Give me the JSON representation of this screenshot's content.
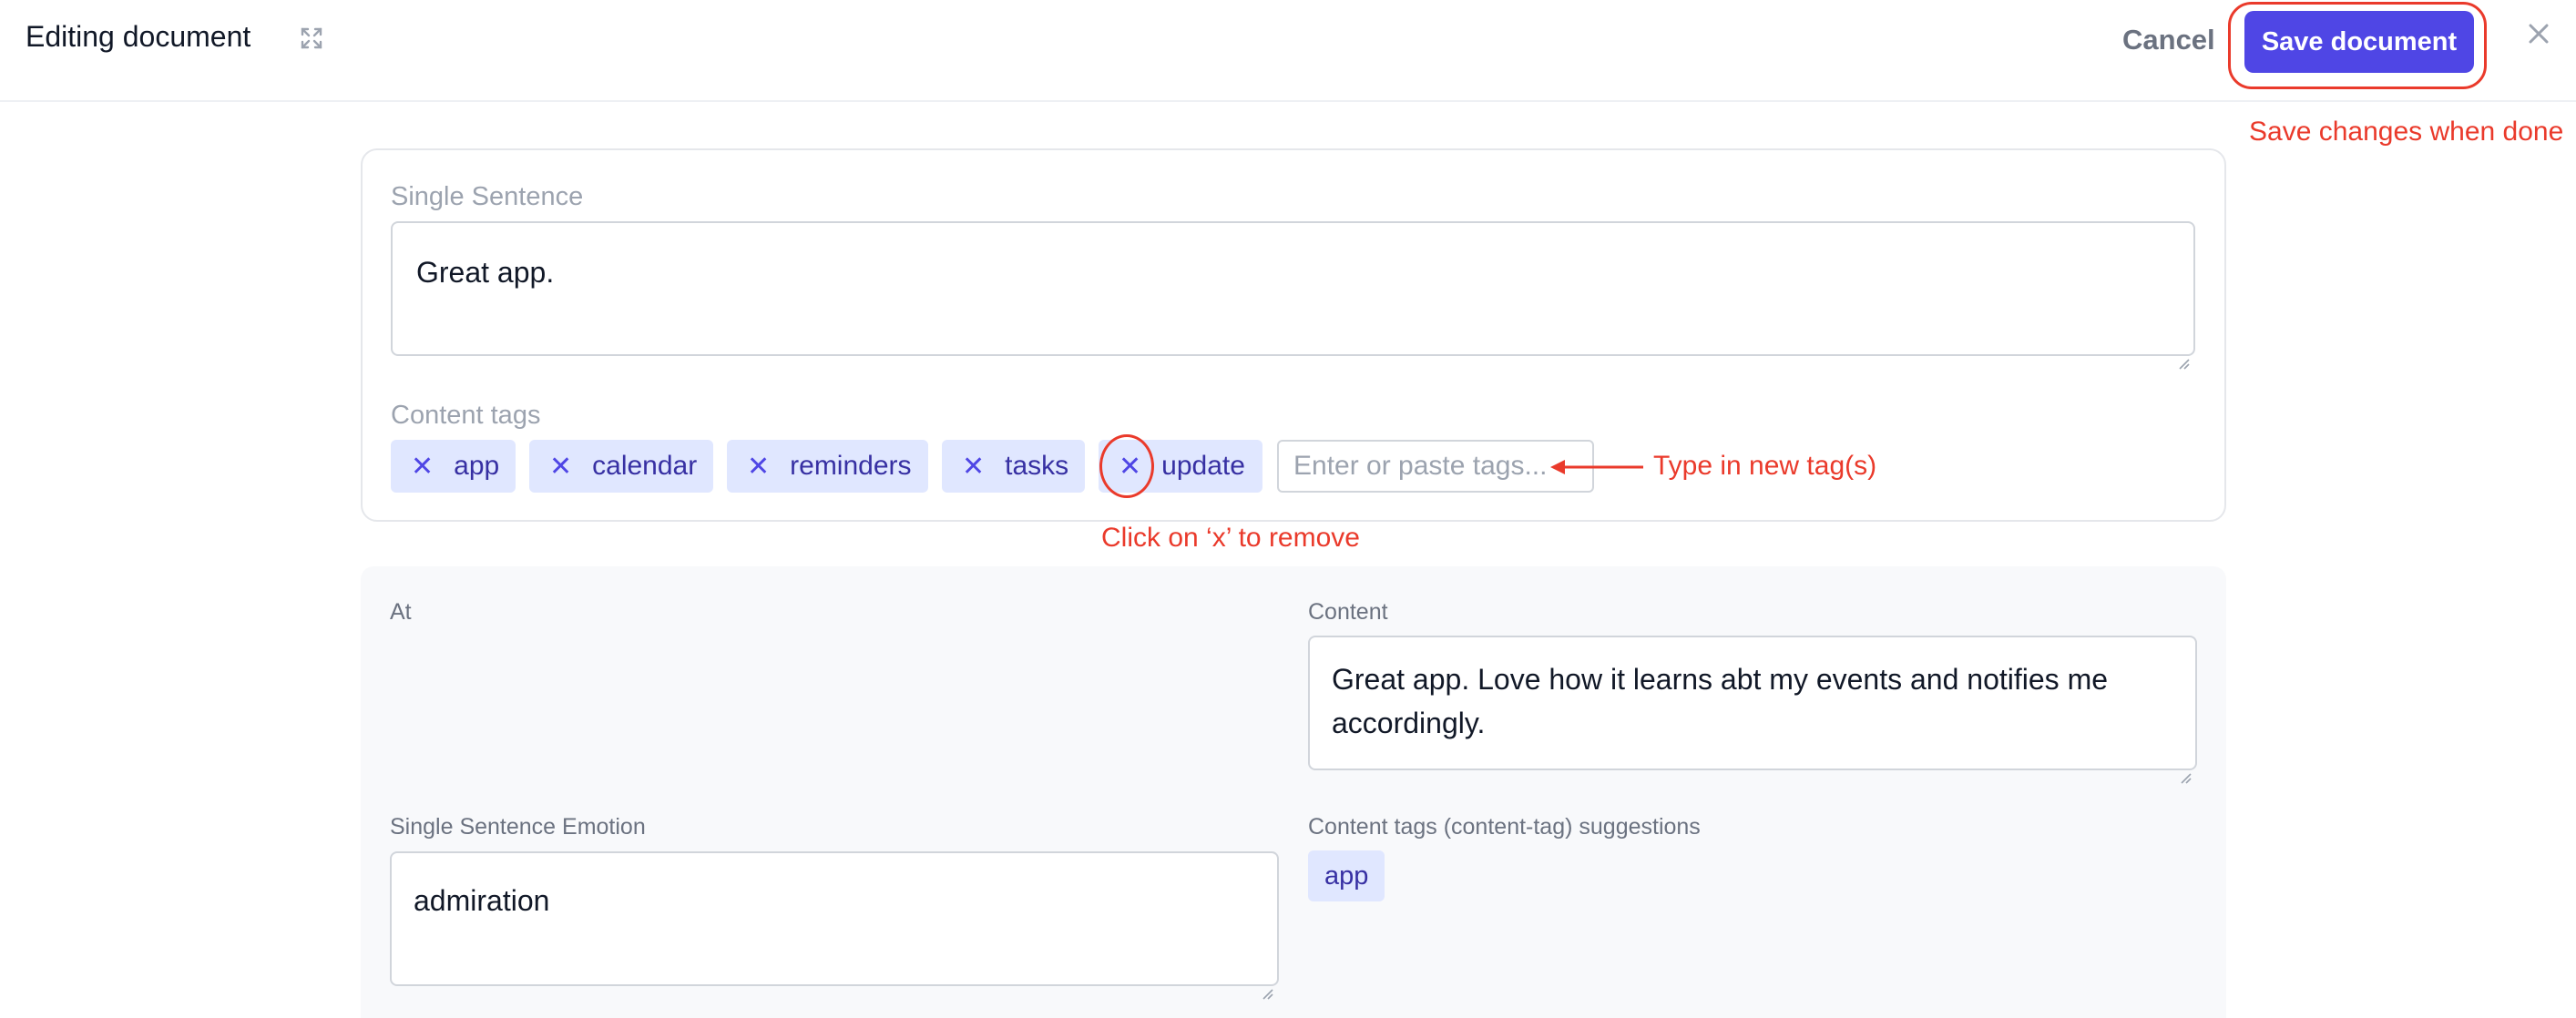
{
  "header": {
    "title": "Editing document",
    "cancel_label": "Cancel",
    "save_label": "Save document"
  },
  "annotations": {
    "save_hint": "Save changes when done",
    "type_hint": "Type in new tag(s)",
    "remove_hint": "Click on ‘x’ to remove"
  },
  "card": {
    "single_sentence_label": "Single Sentence",
    "single_sentence_value": "Great app.",
    "content_tags_label": "Content tags",
    "tags": [
      "app",
      "calendar",
      "reminders",
      "tasks",
      "update"
    ],
    "tag_remove_glyph": "✕",
    "tag_input_placeholder": "Enter or paste tags..."
  },
  "panel": {
    "at_label": "At",
    "content_label": "Content",
    "content_value": "Great app. Love how it learns abt my events and notifies me accordingly.",
    "emotion_label": "Single Sentence Emotion",
    "emotion_value": "admiration",
    "suggestions_label": "Content tags (content-tag) suggestions",
    "suggestions": [
      "app"
    ]
  },
  "colors": {
    "accent": "#4f46e5",
    "tag_bg": "#e0e7ff",
    "tag_text": "#3730a3",
    "annotation": "#ea3a2b"
  },
  "icons": {
    "expand": "expand-icon",
    "close": "close-icon"
  }
}
